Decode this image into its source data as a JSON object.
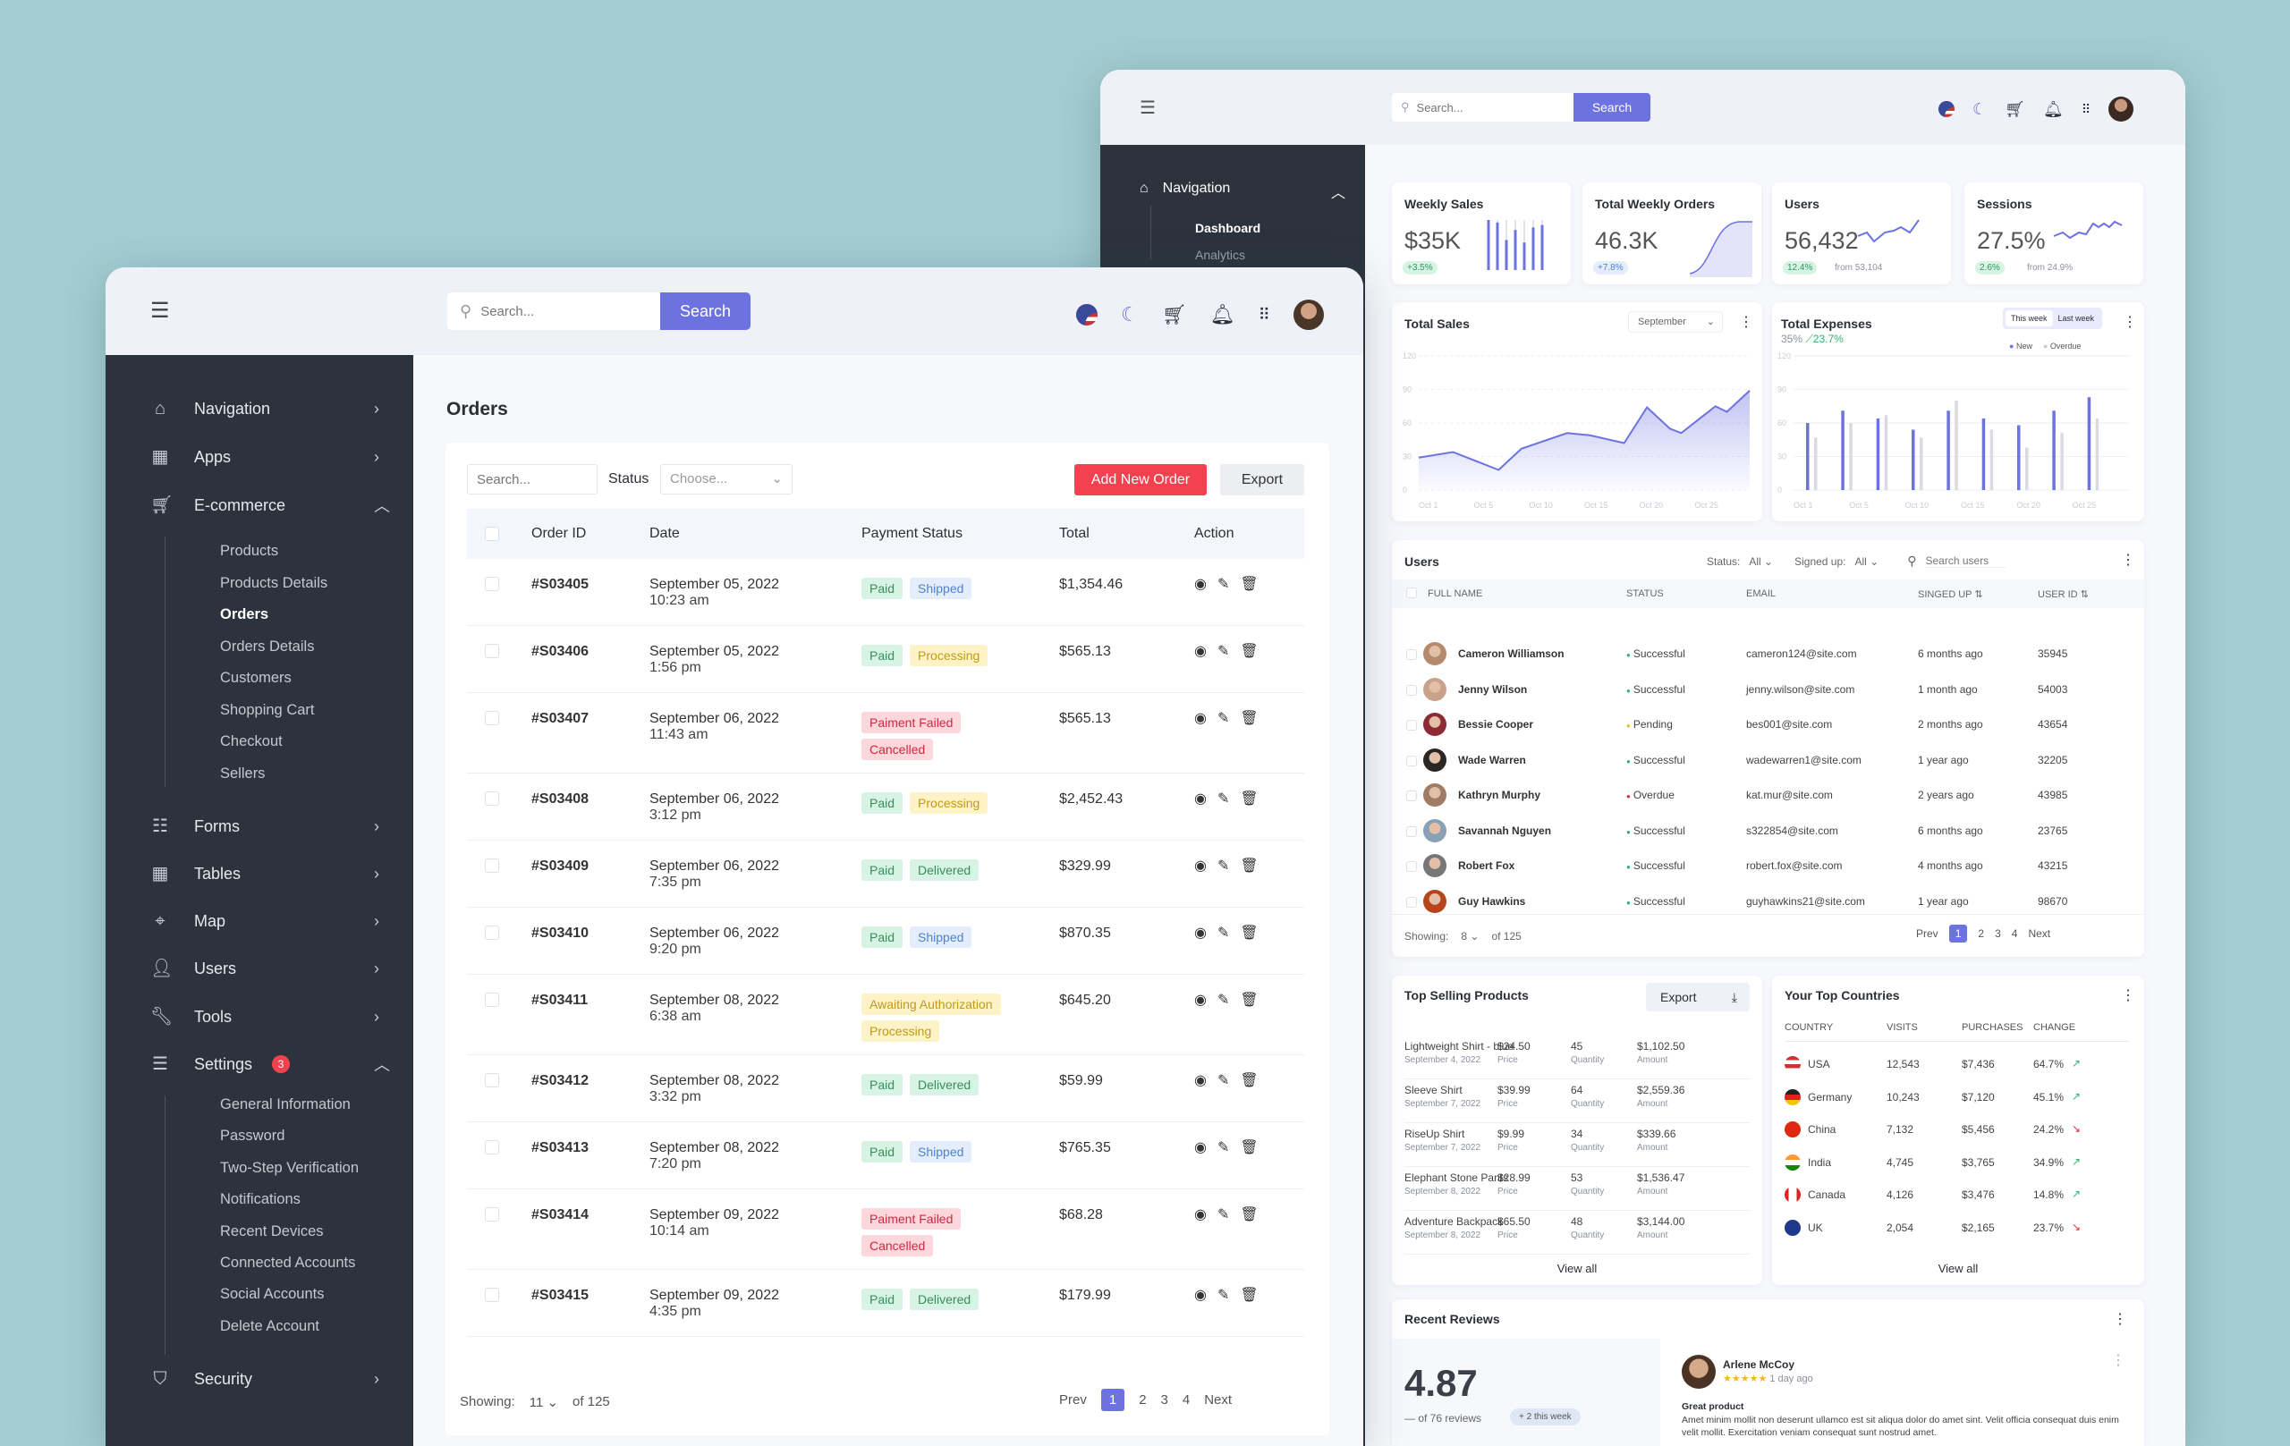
{
  "colors": {
    "accent": "#6c72e0",
    "danger": "#f2424f",
    "success": "#2fb36b",
    "sidebar": "#2d333d",
    "background": "#a3cdd1"
  },
  "back": {
    "header": {
      "menu_icon": "hamburger-icon",
      "search_placeholder": "Search...",
      "search_button": "Search"
    },
    "sidebar": {
      "section": "Navigation",
      "items": [
        "Dashboard",
        "Analytics"
      ]
    },
    "stats": [
      {
        "title": "Weekly Sales",
        "value": "$35K",
        "badge": "+3.5%",
        "spark": [
          100,
          95,
          60,
          80,
          55,
          85,
          90
        ]
      },
      {
        "title": "Total Weekly Orders",
        "value": "46.3K",
        "badge": "+7.8%"
      },
      {
        "title": "Users",
        "value": "56,432",
        "badge": "12.4%",
        "from": "from 53,104"
      },
      {
        "title": "Sessions",
        "value": "27.5%",
        "badge": "2.6%",
        "from": "from 24.9%"
      }
    ],
    "total_sales": {
      "title": "Total Sales",
      "month": "September"
    },
    "total_expenses": {
      "title": "Total Expenses",
      "pct": "35%",
      "change": "23.7%",
      "toggle": [
        "This week",
        "Last week"
      ]
    },
    "users": {
      "title": "Users",
      "status_label": "Status:",
      "status_value": "All",
      "signed_label": "Signed up:",
      "signed_value": "All",
      "search_placeholder": "Search users",
      "columns": [
        "FULL NAME",
        "STATUS",
        "EMAIL",
        "SINGED UP",
        "USER ID"
      ],
      "rows": [
        {
          "name": "Cameron Williamson",
          "status": "Successful",
          "email": "cameron124@site.com",
          "signed": "6 months ago",
          "id": "35945"
        },
        {
          "name": "Jenny Wilson",
          "status": "Successful",
          "email": "jenny.wilson@site.com",
          "signed": "1 month ago",
          "id": "54003"
        },
        {
          "name": "Bessie Cooper",
          "status": "Pending",
          "email": "bes001@site.com",
          "signed": "2 months ago",
          "id": "43654"
        },
        {
          "name": "Wade Warren",
          "status": "Successful",
          "email": "wadewarren1@site.com",
          "signed": "1 year ago",
          "id": "32205"
        },
        {
          "name": "Kathryn Murphy",
          "status": "Overdue",
          "email": "kat.mur@site.com",
          "signed": "2 years ago",
          "id": "43985"
        },
        {
          "name": "Savannah Nguyen",
          "status": "Successful",
          "email": "s322854@site.com",
          "signed": "6 months ago",
          "id": "23765"
        },
        {
          "name": "Robert Fox",
          "status": "Successful",
          "email": "robert.fox@site.com",
          "signed": "4 months ago",
          "id": "43215"
        },
        {
          "name": "Guy Hawkins",
          "status": "Successful",
          "email": "guyhawkins21@site.com",
          "signed": "1 year ago",
          "id": "98670"
        }
      ],
      "showing_label": "Showing:",
      "showing_value": "8",
      "of": "of 125",
      "pager": [
        "Prev",
        "1",
        "2",
        "3",
        "4",
        "Next"
      ]
    },
    "top_products": {
      "title": "Top Selling Products",
      "export": "Export",
      "view_all": "View all",
      "labels": [
        "Price",
        "Quantity",
        "Amount"
      ],
      "rows": [
        {
          "name": "Lightweight Shirt - blue",
          "date": "September 4, 2022",
          "price": "$24.50",
          "qty": "45",
          "amount": "$1,102.50"
        },
        {
          "name": "Sleeve Shirt",
          "date": "September 7, 2022",
          "price": "$39.99",
          "qty": "64",
          "amount": "$2,559.36"
        },
        {
          "name": "RiseUp Shirt",
          "date": "September 7, 2022",
          "price": "$9.99",
          "qty": "34",
          "amount": "$339.66"
        },
        {
          "name": "Elephant Stone Pants",
          "date": "September 8, 2022",
          "price": "$28.99",
          "qty": "53",
          "amount": "$1,536.47"
        },
        {
          "name": "Adventure Backpack",
          "date": "September 8, 2022",
          "price": "$65.50",
          "qty": "48",
          "amount": "$3,144.00"
        }
      ]
    },
    "top_countries": {
      "title": "Your Top Countries",
      "view_all": "View all",
      "columns": [
        "COUNTRY",
        "VISITS",
        "PURCHASES",
        "CHANGE"
      ],
      "rows": [
        {
          "country": "USA",
          "visits": "12,543",
          "purchases": "$7,436",
          "change": "64.7%",
          "trend": "up"
        },
        {
          "country": "Germany",
          "visits": "10,243",
          "purchases": "$7,120",
          "change": "45.1%",
          "trend": "up"
        },
        {
          "country": "China",
          "visits": "7,132",
          "purchases": "$5,456",
          "change": "24.2%",
          "trend": "down"
        },
        {
          "country": "India",
          "visits": "4,745",
          "purchases": "$3,765",
          "change": "34.9%",
          "trend": "up"
        },
        {
          "country": "Canada",
          "visits": "4,126",
          "purchases": "$3,476",
          "change": "14.8%",
          "trend": "up"
        },
        {
          "country": "UK",
          "visits": "2,054",
          "purchases": "$2,165",
          "change": "23.7%",
          "trend": "down"
        }
      ]
    },
    "reviews": {
      "title": "Recent Reviews",
      "score": "4.87",
      "count": "of 76 reviews",
      "week": "+ 2 this week",
      "reviewer": "Arlene McCoy",
      "stars": 5,
      "time": "1 day ago",
      "headline": "Great product",
      "body": "Amet minim mollit non deserunt ullamco est sit aliqua dolor do amet sint. Velit officia consequat duis enim velit mollit. Exercitation veniam consequat sunt nostrud amet."
    }
  },
  "front": {
    "header": {
      "search_placeholder": "Search...",
      "search_button": "Search"
    },
    "sidebar": {
      "items": [
        {
          "label": "Navigation",
          "icon": "home-icon"
        },
        {
          "label": "Apps",
          "icon": "apps-icon"
        },
        {
          "label": "E-commerce",
          "icon": "cart-icon",
          "open": true
        }
      ],
      "ecommerce": [
        "Products",
        "Products Details",
        "Orders",
        "Orders Details",
        "Customers",
        "Shopping Cart",
        "Checkout",
        "Sellers"
      ],
      "active": "Orders",
      "items2": [
        {
          "label": "Forms",
          "icon": "form-icon"
        },
        {
          "label": "Tables",
          "icon": "table-icon"
        },
        {
          "label": "Map",
          "icon": "map-pin-icon"
        },
        {
          "label": "Users",
          "icon": "user-icon"
        },
        {
          "label": "Tools",
          "icon": "wrench-icon"
        }
      ],
      "settings": {
        "label": "Settings",
        "badge": "3"
      },
      "settings_items": [
        "General Information",
        "Password",
        "Two-Step Verification",
        "Notifications",
        "Recent Devices",
        "Connected Accounts",
        "Social Accounts",
        "Delete Account"
      ],
      "security": "Security"
    },
    "orders": {
      "title": "Orders",
      "search_placeholder": "Search...",
      "status_label": "Status",
      "status_placeholder": "Choose...",
      "add_button": "Add New Order",
      "export_button": "Export",
      "columns": [
        "Order ID",
        "Date",
        "Payment Status",
        "Total",
        "Action"
      ],
      "rows": [
        {
          "id": "#S03405",
          "date": "September 05, 2022",
          "time": "10:23 am",
          "badges": [
            "Paid",
            "Shipped"
          ],
          "total": "$1,354.46"
        },
        {
          "id": "#S03406",
          "date": "September 05, 2022",
          "time": "1:56 pm",
          "badges": [
            "Paid",
            "Processing"
          ],
          "total": "$565.13"
        },
        {
          "id": "#S03407",
          "date": "September 06, 2022",
          "time": "11:43 am",
          "badges": [
            "Paiment Failed",
            "Cancelled"
          ],
          "stack": true,
          "total": "$565.13"
        },
        {
          "id": "#S03408",
          "date": "September 06, 2022",
          "time": "3:12 pm",
          "badges": [
            "Paid",
            "Processing"
          ],
          "total": "$2,452.43"
        },
        {
          "id": "#S03409",
          "date": "September 06, 2022",
          "time": "7:35 pm",
          "badges": [
            "Paid",
            "Delivered"
          ],
          "total": "$329.99"
        },
        {
          "id": "#S03410",
          "date": "September 06, 2022",
          "time": "9:20 pm",
          "badges": [
            "Paid",
            "Shipped"
          ],
          "total": "$870.35"
        },
        {
          "id": "#S03411",
          "date": "September 08, 2022",
          "time": "6:38 am",
          "badges": [
            "Awaiting Authorization",
            "Processing"
          ],
          "stack": true,
          "total": "$645.20"
        },
        {
          "id": "#S03412",
          "date": "September 08, 2022",
          "time": "3:32 pm",
          "badges": [
            "Paid",
            "Delivered"
          ],
          "total": "$59.99"
        },
        {
          "id": "#S03413",
          "date": "September 08, 2022",
          "time": "7:20 pm",
          "badges": [
            "Paid",
            "Shipped"
          ],
          "total": "$765.35"
        },
        {
          "id": "#S03414",
          "date": "September 09, 2022",
          "time": "10:14 am",
          "badges": [
            "Paiment Failed",
            "Cancelled"
          ],
          "stack": true,
          "total": "$68.28"
        },
        {
          "id": "#S03415",
          "date": "September 09, 2022",
          "time": "4:35 pm",
          "badges": [
            "Paid",
            "Delivered"
          ],
          "total": "$179.99"
        }
      ],
      "showing_label": "Showing:",
      "showing_value": "11",
      "of": "of 125",
      "pager": [
        "Prev",
        "1",
        "2",
        "3",
        "4",
        "Next"
      ]
    }
  },
  "chart_data": [
    {
      "type": "area",
      "title": "Total Sales",
      "ylim": [
        0,
        120
      ],
      "yticks": [
        0,
        30,
        60,
        90,
        120
      ],
      "xticks": [
        "Oct 1",
        "Oct 5",
        "Oct 10",
        "Oct 15",
        "Oct 20",
        "Oct 25"
      ],
      "grid": true,
      "x": [
        1,
        4,
        8,
        10,
        14,
        16,
        19,
        21,
        23,
        24,
        27,
        28,
        30
      ],
      "values": [
        29,
        34,
        18,
        37,
        51,
        49,
        42,
        74,
        55,
        51,
        75,
        70,
        89
      ]
    },
    {
      "type": "bar",
      "title": "Total Expenses",
      "ylim": [
        0,
        120
      ],
      "yticks": [
        0,
        30,
        60,
        90,
        120
      ],
      "xticks": [
        "Oct 1",
        "Oct 5",
        "Oct 10",
        "Oct 15",
        "Oct 20",
        "Oct 25"
      ],
      "grid": true,
      "legend": "top-right",
      "series": [
        {
          "name": "New",
          "color": "#6c72e0",
          "values": [
            60,
            71,
            64,
            54,
            71,
            64,
            58,
            71,
            83
          ]
        },
        {
          "name": "Overdue",
          "color": "#d9dbe0",
          "values": [
            47,
            60,
            67,
            47,
            80,
            54,
            38,
            51,
            64
          ]
        }
      ]
    }
  ]
}
